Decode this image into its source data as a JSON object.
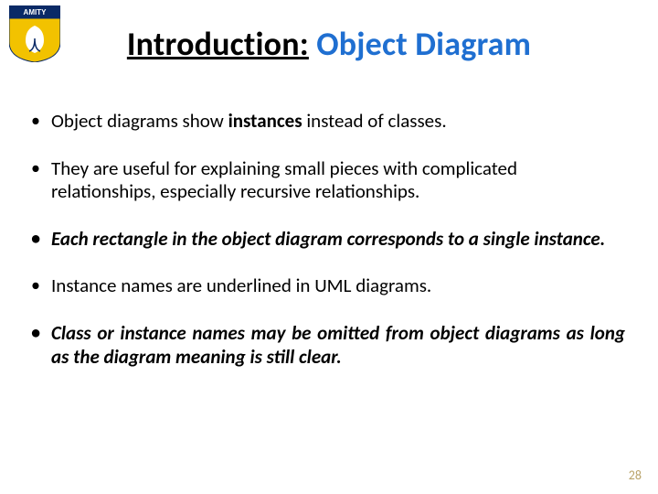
{
  "logo_alt": "amity-logo",
  "title": {
    "intro": "Introduction:",
    "object_diagram": "Object Diagram"
  },
  "bullets": {
    "b1_pre": "Object diagrams show ",
    "b1_bold": "instances",
    "b1_post": " instead of classes.",
    "b2": "They are useful for explaining small pieces with complicated relationships, especially recursive relationships.",
    "b3": "Each rectangle in the object diagram corresponds to a single instance.",
    "b4": "Instance names are underlined in UML diagrams.",
    "b5": "Class or instance names may be omitted from object diagrams as long as the diagram meaning is still clear."
  },
  "page_number": "28"
}
